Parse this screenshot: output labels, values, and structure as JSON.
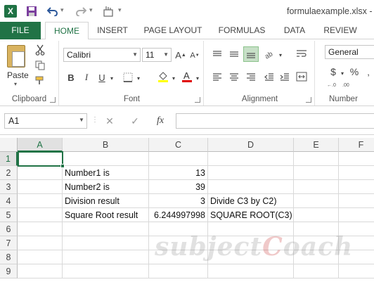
{
  "window": {
    "logo_text": "X",
    "title": "formulaexample.xlsx - E"
  },
  "quick_access": {
    "save_icon": "save-icon",
    "undo_icon": "undo-icon",
    "redo_icon": "redo-icon",
    "touch_icon": "touch-mode-icon"
  },
  "tabs": [
    {
      "label": "FILE"
    },
    {
      "label": "HOME"
    },
    {
      "label": "INSERT"
    },
    {
      "label": "PAGE LAYOUT"
    },
    {
      "label": "FORMULAS"
    },
    {
      "label": "DATA"
    },
    {
      "label": "REVIEW"
    }
  ],
  "ribbon": {
    "clipboard": {
      "label": "Clipboard",
      "paste_label": "Paste"
    },
    "font": {
      "label": "Font",
      "font_name": "Calibri",
      "font_size": "11",
      "bold": "B",
      "italic": "I",
      "underline": "U"
    },
    "alignment": {
      "label": "Alignment"
    },
    "number": {
      "label": "Number",
      "format": "General",
      "currency": "$",
      "percent": "%"
    }
  },
  "formula_bar": {
    "name_box": "A1",
    "cancel": "✕",
    "enter": "✓",
    "fx": "fx",
    "value": ""
  },
  "columns": [
    "A",
    "B",
    "C",
    "D",
    "E",
    "F"
  ],
  "rows": [
    "1",
    "2",
    "3",
    "4",
    "5",
    "6",
    "7",
    "8",
    "9"
  ],
  "cells": {
    "B2": "Number1 is",
    "C2": "13",
    "B3": "Number2 is",
    "C3": "39",
    "B4": "Division result",
    "C4": "3",
    "D4": "Divide C3 by C2)",
    "B5": "Square Root result",
    "C5": "6.244997998",
    "D5": "SQUARE ROOT(C3)"
  },
  "watermark": {
    "part1": "subject",
    "part2": "C",
    "part3": "oach"
  },
  "colors": {
    "accent": "#217346"
  }
}
